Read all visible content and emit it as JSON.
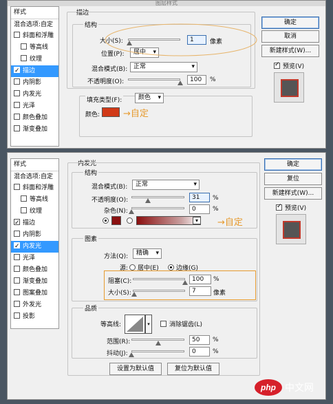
{
  "dialog1": {
    "title": "图层样式",
    "styles_header": "样式",
    "blend_options": "混合选项:自定",
    "style_items": [
      {
        "label": "斜面和浮雕",
        "checked": false,
        "indent": false
      },
      {
        "label": "等高线",
        "checked": false,
        "indent": true
      },
      {
        "label": "纹理",
        "checked": false,
        "indent": true
      },
      {
        "label": "描边",
        "checked": true,
        "indent": false,
        "selected": true
      },
      {
        "label": "内阴影",
        "checked": false,
        "indent": false
      },
      {
        "label": "内发光",
        "checked": false,
        "indent": false
      },
      {
        "label": "光泽",
        "checked": false,
        "indent": false
      },
      {
        "label": "颜色叠加",
        "checked": false,
        "indent": false
      },
      {
        "label": "渐变叠加",
        "checked": false,
        "indent": false
      }
    ],
    "panel_title": "描边",
    "structure_title": "结构",
    "size_label": "大小(S):",
    "size_value": "1",
    "size_unit": "像素",
    "size_fraction": 0.02,
    "position_label": "位置(P):",
    "position_value": "居中",
    "blend_mode_label": "混合模式(B):",
    "blend_mode_value": "正常",
    "opacity_label": "不透明度(O):",
    "opacity_value": "100",
    "opacity_unit": "%",
    "opacity_fraction": 1.0,
    "fill_type_label": "填充类型(F):",
    "fill_type_value": "颜色",
    "color_label": "颜色:",
    "stroke_color": "#d13a18",
    "annotation": "→自定",
    "buttons": {
      "ok": "确定",
      "cancel": "取消",
      "new_style": "新建样式(W)...",
      "preview": "预览(V)"
    }
  },
  "dialog2": {
    "styles_header": "样式",
    "blend_options": "混合选项:自定",
    "style_items": [
      {
        "label": "斜面和浮雕",
        "checked": false,
        "indent": false
      },
      {
        "label": "等高线",
        "checked": false,
        "indent": true
      },
      {
        "label": "纹理",
        "checked": false,
        "indent": true
      },
      {
        "label": "描边",
        "checked": true,
        "indent": false
      },
      {
        "label": "内阴影",
        "checked": false,
        "indent": false
      },
      {
        "label": "内发光",
        "checked": true,
        "indent": false,
        "selected": true
      },
      {
        "label": "光泽",
        "checked": false,
        "indent": false
      },
      {
        "label": "颜色叠加",
        "checked": false,
        "indent": false
      },
      {
        "label": "渐变叠加",
        "checked": false,
        "indent": false
      },
      {
        "label": "图案叠加",
        "checked": false,
        "indent": false
      },
      {
        "label": "外发光",
        "checked": false,
        "indent": false
      },
      {
        "label": "投影",
        "checked": false,
        "indent": false
      }
    ],
    "panel_title": "内发光",
    "structure_title": "结构",
    "blend_mode_label": "混合模式(B):",
    "blend_mode_value": "正常",
    "opacity_label": "不透明度(O):",
    "opacity_value": "31",
    "opacity_unit": "%",
    "opacity_fraction": 0.31,
    "noise_label": "杂色(N):",
    "noise_value": "0",
    "noise_unit": "%",
    "noise_fraction": 0.0,
    "glow_color": "#8b1010",
    "annotation": "→自定",
    "elements_title": "图素",
    "method_label": "方法(Q):",
    "method_value": "精确",
    "source_label": "源:",
    "source_center": "居中(E)",
    "source_edge": "边缘(G)",
    "choke_label": "阻塞(C):",
    "choke_value": "100",
    "choke_unit": "%",
    "choke_fraction": 1.0,
    "size_label": "大小(S):",
    "size_value": "7",
    "size_unit": "像素",
    "size_fraction": 0.03,
    "quality_title": "品质",
    "contour_label": "等高线:",
    "antialias_label": "消除锯齿(L)",
    "range_label": "范围(R):",
    "range_value": "50",
    "range_unit": "%",
    "range_fraction": 0.5,
    "jitter_label": "抖动(J):",
    "jitter_value": "0",
    "jitter_unit": "%",
    "jitter_fraction": 0.0,
    "set_default": "设置为默认值",
    "reset_default": "复位为默认值",
    "buttons": {
      "ok": "确定",
      "reset": "复位",
      "new_style": "新建样式(W)...",
      "preview": "预览(V)"
    }
  },
  "watermark": {
    "logo": "php",
    "text": "中文网"
  },
  "colors": {
    "selection": "#3399ff",
    "annotation": "#e69a2e",
    "watermark_red": "#d6202a"
  }
}
